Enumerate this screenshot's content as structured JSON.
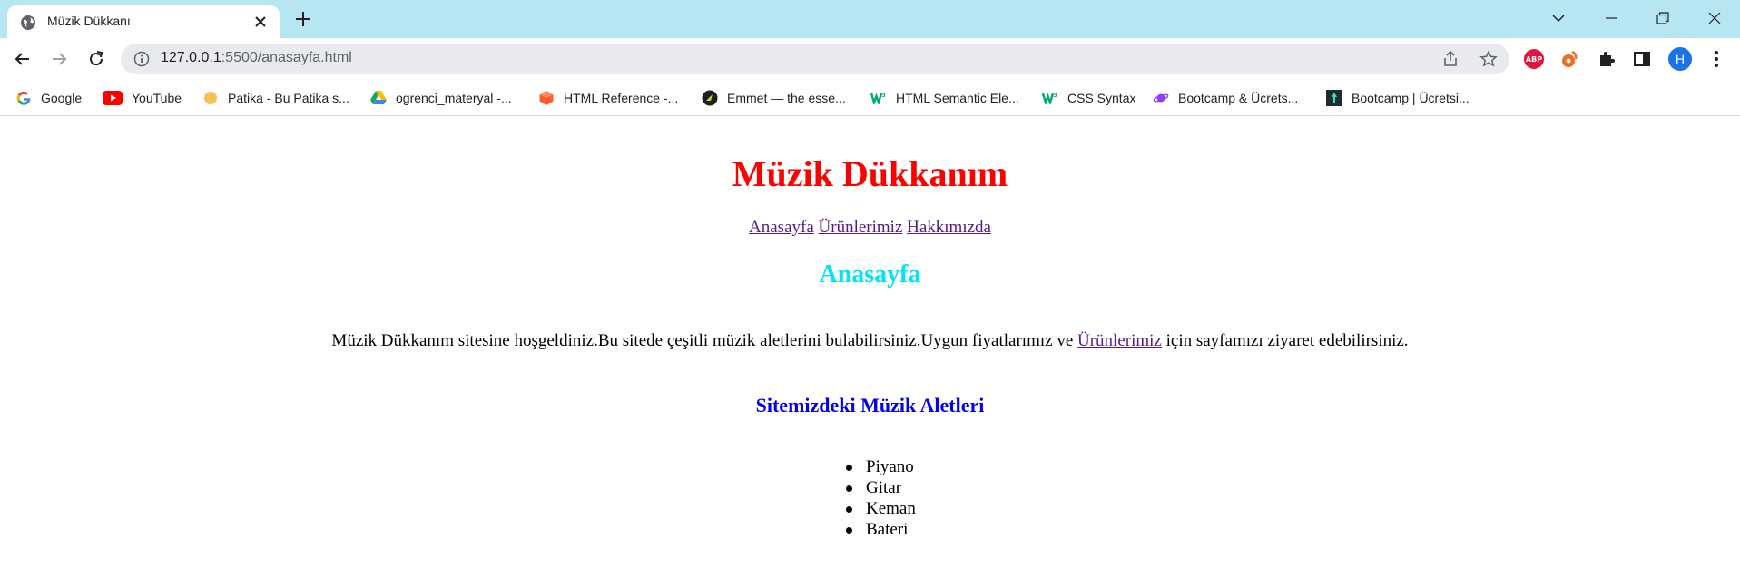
{
  "browser": {
    "tab": {
      "title": "Müzik Dükkanı"
    },
    "address_bar": {
      "host": "127.0.0.1",
      "path": ":5500/anasayfa.html"
    },
    "profile_initial": "H",
    "abp_label": "ABP",
    "bookmarks": [
      {
        "label": "Google",
        "icon": "google-icon"
      },
      {
        "label": "YouTube",
        "icon": "youtube-icon"
      },
      {
        "label": "Patika - Bu Patika s...",
        "icon": "patika-icon"
      },
      {
        "label": "ogrenci_materyal -...",
        "icon": "google-drive-icon"
      },
      {
        "label": "HTML Reference -...",
        "icon": "html-reference-icon"
      },
      {
        "label": "Emmet — the esse...",
        "icon": "emmet-icon"
      },
      {
        "label": "HTML Semantic Ele...",
        "icon": "w3schools-icon"
      },
      {
        "label": "CSS Syntax",
        "icon": "w3schools-icon"
      },
      {
        "label": "Bootcamp & Ücrets...",
        "icon": "planet-icon"
      },
      {
        "label": "Bootcamp | Ücretsi...",
        "icon": "bootcamp-icon"
      }
    ],
    "colors": {
      "tabbar": "#b5e6f2",
      "omnibox": "#e8eaed",
      "accent": "#1a73e8"
    }
  },
  "page": {
    "heading": "Müzik Dükkanım",
    "nav": [
      "Anasayfa",
      "Ürünlerimiz",
      "Hakkımızda"
    ],
    "section_title": "Anasayfa",
    "paragraph": {
      "before_link": "Müzik Dükkanım sitesine hoşgeldiniz.Bu sitede çeşitli müzik aletlerini bulabilirsiniz.Uygun fiyatlarımız ve ",
      "link": "Ürünlerimiz",
      "after_link": " için sayfamızı ziyaret edebilirsiniz."
    },
    "list_title": "Sitemizdeki Müzik Aletleri",
    "instruments": [
      "Piyano",
      "Gitar",
      "Keman",
      "Bateri"
    ],
    "colors": {
      "heading": "#ff0000",
      "section_title": "#00e5ee",
      "list_title": "#0000ee",
      "link": "#551a8b"
    }
  }
}
